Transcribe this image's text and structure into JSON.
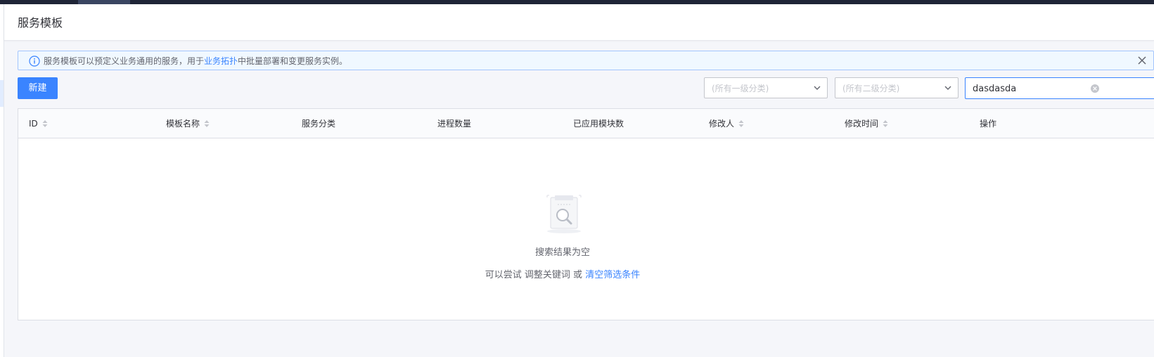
{
  "header": {
    "title": "服务模板"
  },
  "info": {
    "prefix": "服务模板可以预定义业务通用的服务，用于",
    "link": "业务拓扑",
    "suffix": "中批量部署和变更服务实例。"
  },
  "toolbar": {
    "new_label": "新建",
    "category_1_placeholder": "(所有一级分类)",
    "category_2_placeholder": "(所有二级分类)",
    "search_value": "dasdasda"
  },
  "table": {
    "columns": [
      {
        "label": "ID",
        "sortable": true
      },
      {
        "label": "模板名称",
        "sortable": true
      },
      {
        "label": "服务分类",
        "sortable": false
      },
      {
        "label": "进程数量",
        "sortable": false
      },
      {
        "label": "已应用模块数",
        "sortable": false
      },
      {
        "label": "修改人",
        "sortable": true
      },
      {
        "label": "修改时间",
        "sortable": true
      },
      {
        "label": "操作",
        "sortable": false
      }
    ]
  },
  "empty": {
    "title": "搜索结果为空",
    "tip_prefix": "可以尝试 调整关键词 或 ",
    "tip_link": "清空筛选条件"
  },
  "colors": {
    "primary": "#3a84ff",
    "topbar": "#1f2537",
    "info_bg": "#f0f8ff"
  },
  "icons": {
    "info": "info-icon",
    "close": "close-icon",
    "dropdown": "chevron-down-icon",
    "clear": "clear-icon",
    "sort": "sort-icon",
    "empty": "empty-search-icon"
  }
}
